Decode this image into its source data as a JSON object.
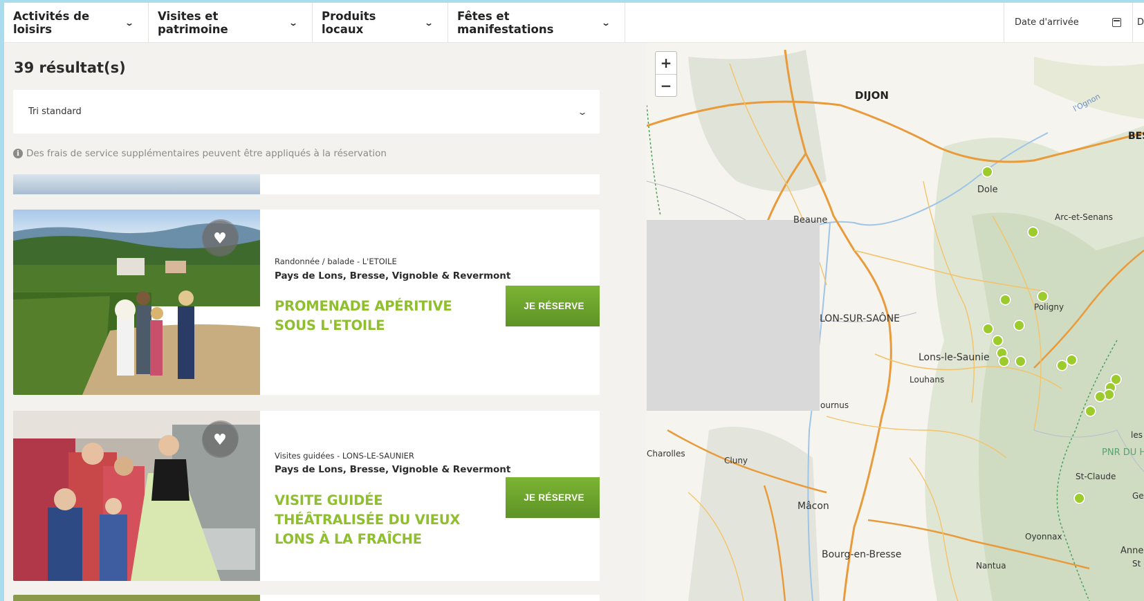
{
  "filters": [
    {
      "label": "Activités de loisirs"
    },
    {
      "label": "Visites et patrimoine"
    },
    {
      "label": "Produits locaux"
    },
    {
      "label": "Fêtes et manifestations"
    }
  ],
  "dates": {
    "arrival": "Date d'arrivée",
    "departure": "Da"
  },
  "results": {
    "count": "39 résultat(s)",
    "sort": "Tri standard",
    "notice": "Des frais de service supplémentaires peuvent être appliqués à la réservation"
  },
  "cards": [
    {
      "meta": "Randonnée / balade - L'ETOILE",
      "region": "Pays de Lons, Bresse, Vignoble & Revermont",
      "title": "PROMENADE APÉRITIVE SOUS L'ETOILE",
      "button": "JE RÉSERVE"
    },
    {
      "meta": "Visites guidées - LONS-LE-SAUNIER",
      "region": "Pays de Lons, Bresse, Vignoble & Revermont",
      "title": "VISITE GUIDÉE THÉÂTRALISÉE DU VIEUX LONS À LA FRAÎCHE",
      "button": "JE RÉSERVE"
    }
  ],
  "map": {
    "zoom_in": "+",
    "zoom_out": "−",
    "places": {
      "dijon": "DIJON",
      "dole": "Dole",
      "beaune": "Beaune",
      "arc": "Arc-et-Senans",
      "poligny": "Poligny",
      "chalon": "LON-SUR-SAÔNE",
      "lons": "Lons-le-Saunie",
      "louhans": "Louhans",
      "tournus": "ournus",
      "charolles": "Charolles",
      "cluny": "Cluny",
      "macon": "Mâcon",
      "bourg": "Bourg-en-Bresse",
      "nantua": "Nantua",
      "oyonnax": "Oyonnax",
      "stclaude": "St-Claude",
      "pnr": "PNR DU H",
      "bes": "BES",
      "les": "les",
      "annecy": "Anne",
      "gex": "Gex",
      "st": "St",
      "ognon": "l'Ognon"
    }
  }
}
